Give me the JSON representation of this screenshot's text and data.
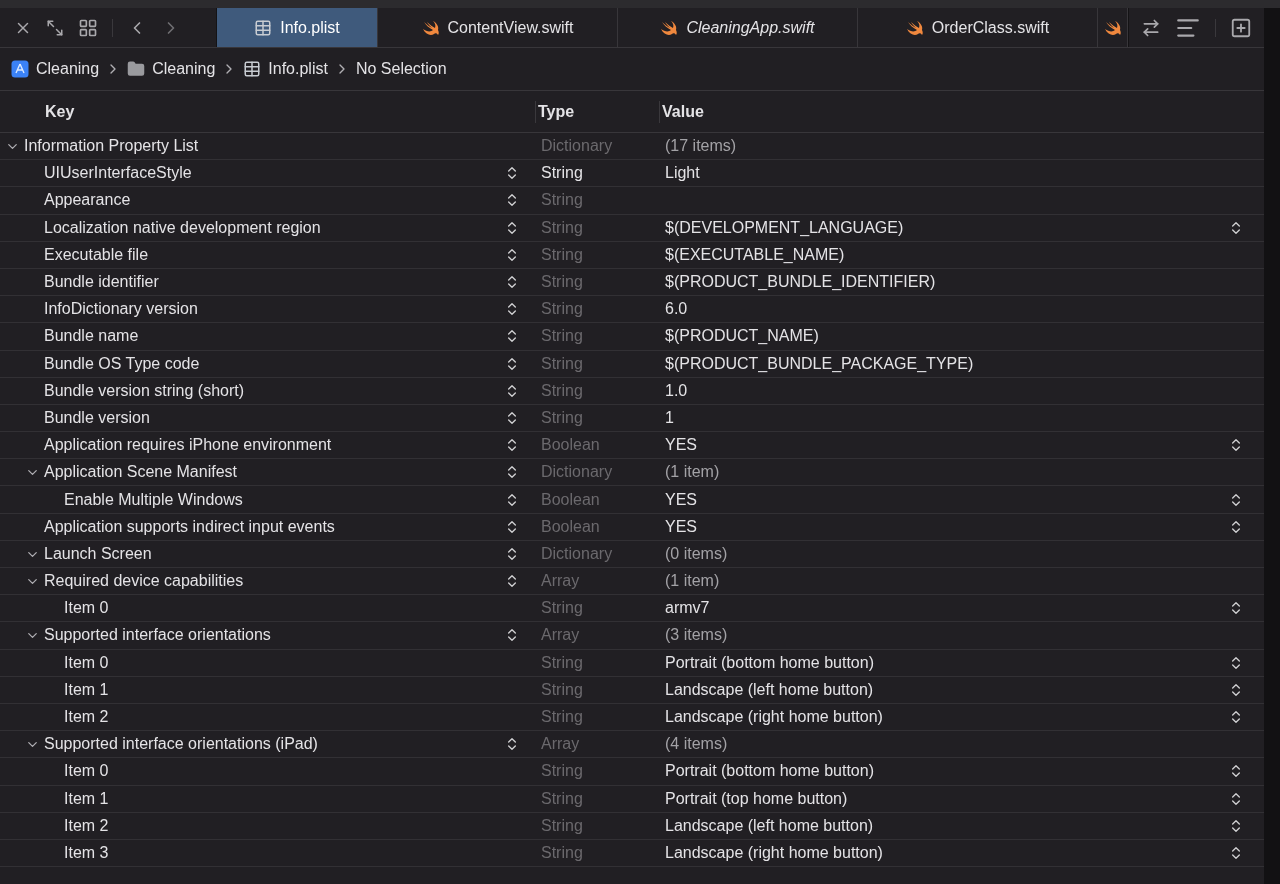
{
  "tabs": [
    {
      "label": "Info.plist",
      "kind": "plist",
      "selected": true,
      "italic": false
    },
    {
      "label": "ContentView.swift",
      "kind": "swift",
      "selected": false,
      "italic": false
    },
    {
      "label": "CleaningApp.swift",
      "kind": "swift",
      "selected": false,
      "italic": true
    },
    {
      "label": "OrderClass.swift",
      "kind": "swift",
      "selected": false,
      "italic": false
    },
    {
      "kind": "swift",
      "selected": false
    }
  ],
  "breadcrumb": [
    {
      "label": "Cleaning",
      "kind": "app"
    },
    {
      "label": "Cleaning",
      "kind": "folder"
    },
    {
      "label": "Info.plist",
      "kind": "plist"
    },
    {
      "label": "No Selection"
    }
  ],
  "table": {
    "columns": [
      "Key",
      "Type",
      "Value"
    ],
    "rows": [
      {
        "key": "Information Property List",
        "type": "Dictionary",
        "value": "(17 items)",
        "kind": "collection",
        "expanded": true,
        "key_stepper": false,
        "value_stepper": false,
        "type_dim": true,
        "children": [
          {
            "key": "UIUserInterfaceStyle",
            "type": "String",
            "value": "Light",
            "kind": "value",
            "key_stepper": true,
            "value_stepper": false,
            "type_dim": false
          },
          {
            "key": "Appearance",
            "type": "String",
            "kind": "value",
            "key_stepper": true,
            "value_stepper": false,
            "type_dim": true
          },
          {
            "key": "Localization native development region",
            "type": "String",
            "value": "$(DEVELOPMENT_LANGUAGE)",
            "kind": "value",
            "key_stepper": true,
            "value_stepper": true,
            "type_dim": true
          },
          {
            "key": "Executable file",
            "type": "String",
            "value": "$(EXECUTABLE_NAME)",
            "kind": "value",
            "key_stepper": true,
            "value_stepper": false,
            "type_dim": true
          },
          {
            "key": "Bundle identifier",
            "type": "String",
            "value": "$(PRODUCT_BUNDLE_IDENTIFIER)",
            "kind": "value",
            "key_stepper": true,
            "value_stepper": false,
            "type_dim": true
          },
          {
            "key": "InfoDictionary version",
            "type": "String",
            "value": "6.0",
            "kind": "value",
            "key_stepper": true,
            "value_stepper": false,
            "type_dim": true
          },
          {
            "key": "Bundle name",
            "type": "String",
            "value": "$(PRODUCT_NAME)",
            "kind": "value",
            "key_stepper": true,
            "value_stepper": false,
            "type_dim": true
          },
          {
            "key": "Bundle OS Type code",
            "type": "String",
            "value": "$(PRODUCT_BUNDLE_PACKAGE_TYPE)",
            "kind": "value",
            "key_stepper": true,
            "value_stepper": false,
            "type_dim": true
          },
          {
            "key": "Bundle version string (short)",
            "type": "String",
            "value": "1.0",
            "kind": "value",
            "key_stepper": true,
            "value_stepper": false,
            "type_dim": true
          },
          {
            "key": "Bundle version",
            "type": "String",
            "value": "1",
            "kind": "value",
            "key_stepper": true,
            "value_stepper": false,
            "type_dim": true
          },
          {
            "key": "Application requires iPhone environment",
            "type": "Boolean",
            "value": "YES",
            "kind": "value",
            "key_stepper": true,
            "value_stepper": true,
            "type_dim": true
          },
          {
            "key": "Application Scene Manifest",
            "type": "Dictionary",
            "value": "(1 item)",
            "kind": "collection",
            "expanded": true,
            "key_stepper": true,
            "value_stepper": false,
            "type_dim": true,
            "children": [
              {
                "key": "Enable Multiple Windows",
                "type": "Boolean",
                "value": "YES",
                "kind": "value",
                "key_stepper": true,
                "value_stepper": true,
                "type_dim": true
              }
            ]
          },
          {
            "key": "Application supports indirect input events",
            "type": "Boolean",
            "value": "YES",
            "kind": "value",
            "key_stepper": true,
            "value_stepper": true,
            "type_dim": true
          },
          {
            "key": "Launch Screen",
            "type": "Dictionary",
            "value": "(0 items)",
            "kind": "collection",
            "expanded": true,
            "key_stepper": true,
            "value_stepper": false,
            "type_dim": true
          },
          {
            "key": "Required device capabilities",
            "type": "Array",
            "value": "(1 item)",
            "kind": "collection",
            "expanded": true,
            "key_stepper": true,
            "value_stepper": false,
            "type_dim": true,
            "children": [
              {
                "key": "Item 0",
                "type": "String",
                "value": "armv7",
                "kind": "value",
                "key_stepper": false,
                "value_stepper": true,
                "type_dim": true
              }
            ]
          },
          {
            "key": "Supported interface orientations",
            "type": "Array",
            "value": "(3 items)",
            "kind": "collection",
            "expanded": true,
            "key_stepper": true,
            "value_stepper": false,
            "type_dim": true,
            "children": [
              {
                "key": "Item 0",
                "type": "String",
                "value": "Portrait (bottom home button)",
                "kind": "value",
                "key_stepper": false,
                "value_stepper": true,
                "type_dim": true
              },
              {
                "key": "Item 1",
                "type": "String",
                "value": "Landscape (left home button)",
                "kind": "value",
                "key_stepper": false,
                "value_stepper": true,
                "type_dim": true
              },
              {
                "key": "Item 2",
                "type": "String",
                "value": "Landscape (right home button)",
                "kind": "value",
                "key_stepper": false,
                "value_stepper": true,
                "type_dim": true
              }
            ]
          },
          {
            "key": "Supported interface orientations (iPad)",
            "type": "Array",
            "value": "(4 items)",
            "kind": "collection",
            "expanded": true,
            "key_stepper": true,
            "value_stepper": false,
            "type_dim": true,
            "children": [
              {
                "key": "Item 0",
                "type": "String",
                "value": "Portrait (bottom home button)",
                "kind": "value",
                "key_stepper": false,
                "value_stepper": true,
                "type_dim": true
              },
              {
                "key": "Item 1",
                "type": "String",
                "value": "Portrait (top home button)",
                "kind": "value",
                "key_stepper": false,
                "value_stepper": true,
                "type_dim": true
              },
              {
                "key": "Item 2",
                "type": "String",
                "value": "Landscape (left home button)",
                "kind": "value",
                "key_stepper": false,
                "value_stepper": true,
                "type_dim": true
              },
              {
                "key": "Item 3",
                "type": "String",
                "value": "Landscape (right home button)",
                "kind": "value",
                "key_stepper": false,
                "value_stepper": true,
                "type_dim": true
              }
            ]
          }
        ]
      }
    ]
  }
}
